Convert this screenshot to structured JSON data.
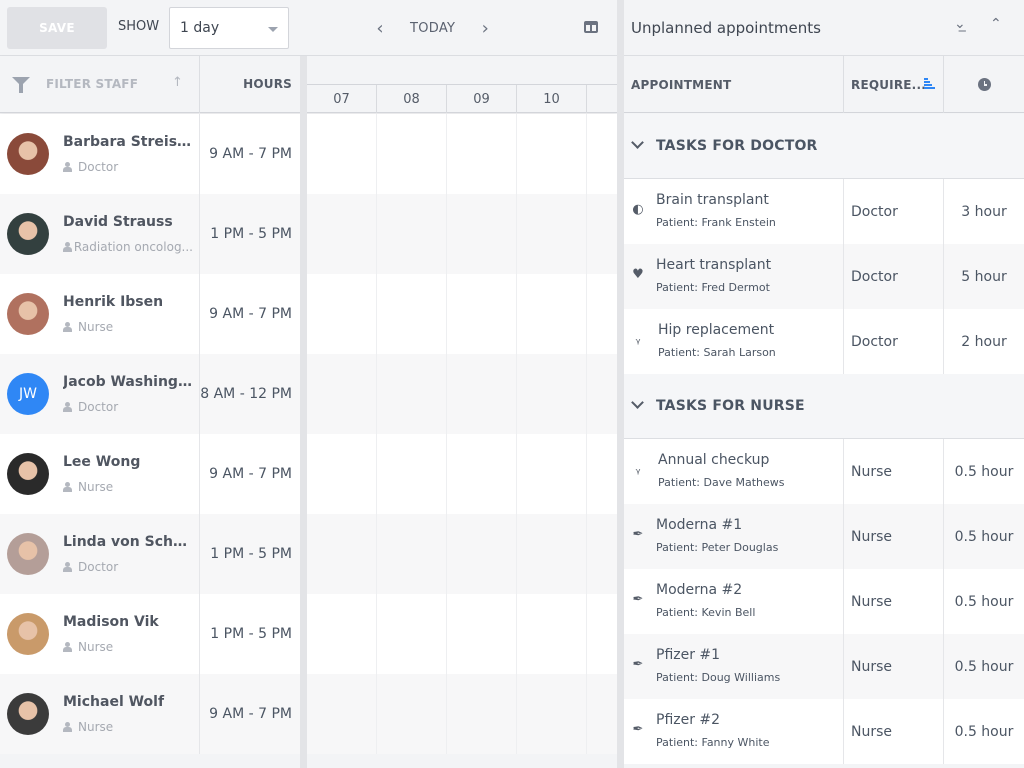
{
  "toolbar": {
    "save_label": "SAVE",
    "show_label": "SHOW",
    "show_value": "1 day",
    "today_label": "TODAY",
    "prev_icon": "chevron-left-icon",
    "next_icon": "chevron-right-icon",
    "layout_icon": "layout-columns-icon"
  },
  "grid": {
    "filter_label": "FILTER STAFF",
    "hours_header": "HOURS",
    "time_columns": [
      "07",
      "08",
      "09",
      "10"
    ]
  },
  "staff": [
    {
      "name": "Barbara Streisa...",
      "role": "Doctor",
      "hours": "9 AM - 7 PM",
      "avatar": "photo",
      "initials": "",
      "color": "#8a4a3a"
    },
    {
      "name": "David Strauss",
      "role": "Radiation oncolog...",
      "hours": "1 PM - 5 PM",
      "avatar": "photo",
      "initials": "",
      "color": "#33403f"
    },
    {
      "name": "Henrik Ibsen",
      "role": "Nurse",
      "hours": "9 AM - 7 PM",
      "avatar": "photo",
      "initials": "",
      "color": "#b0715f"
    },
    {
      "name": "Jacob Washingt...",
      "role": "Doctor",
      "hours": "8 AM - 12 PM",
      "avatar": "initials",
      "initials": "JW",
      "color": "#2f87f5"
    },
    {
      "name": "Lee Wong",
      "role": "Nurse",
      "hours": "9 AM - 7 PM",
      "avatar": "photo",
      "initials": "",
      "color": "#2a2a2a"
    },
    {
      "name": "Linda von Schmi...",
      "role": "Doctor",
      "hours": "1 PM - 5 PM",
      "avatar": "photo",
      "initials": "",
      "color": "#b49e98"
    },
    {
      "name": "Madison Vik",
      "role": "Nurse",
      "hours": "1 PM - 5 PM",
      "avatar": "photo",
      "initials": "",
      "color": "#c99a6a"
    },
    {
      "name": "Michael Wolf",
      "role": "Nurse",
      "hours": "9 AM - 7 PM",
      "avatar": "photo",
      "initials": "",
      "color": "#3b3b3b"
    }
  ],
  "unplanned": {
    "title": "Unplanned appointments",
    "expand_all_icon": "chevrons-down-icon",
    "collapse_all_icon": "chevrons-up-icon",
    "columns": {
      "appointment": "APPOINTMENT",
      "required": "REQUIRE...",
      "duration_icon": "clock-icon"
    },
    "accent_color": "#2f87f5",
    "groups": [
      {
        "label": "TASKS FOR DOCTOR",
        "tasks": [
          {
            "name": "Brain transplant",
            "patient": "Patient: Frank Enstein",
            "required": "Doctor",
            "duration": "3 hour",
            "icon": "brain-icon"
          },
          {
            "name": "Heart transplant",
            "patient": "Patient: Fred Dermot",
            "required": "Doctor",
            "duration": "5 hour",
            "icon": "heart-icon"
          },
          {
            "name": "Hip replacement",
            "patient": "Patient: Sarah Larson",
            "required": "Doctor",
            "duration": "2 hour",
            "icon": "stethoscope-icon"
          }
        ]
      },
      {
        "label": "TASKS FOR NURSE",
        "tasks": [
          {
            "name": "Annual checkup",
            "patient": "Patient: Dave Mathews",
            "required": "Nurse",
            "duration": "0.5 hour",
            "icon": "stethoscope-icon"
          },
          {
            "name": "Moderna #1",
            "patient": "Patient: Peter Douglas",
            "required": "Nurse",
            "duration": "0.5 hour",
            "icon": "syringe-icon"
          },
          {
            "name": "Moderna #2",
            "patient": "Patient: Kevin Bell",
            "required": "Nurse",
            "duration": "0.5 hour",
            "icon": "syringe-icon"
          },
          {
            "name": "Pfizer #1",
            "patient": "Patient: Doug Williams",
            "required": "Nurse",
            "duration": "0.5 hour",
            "icon": "syringe-icon"
          },
          {
            "name": "Pfizer #2",
            "patient": "Patient: Fanny White",
            "required": "Nurse",
            "duration": "0.5 hour",
            "icon": "syringe-icon"
          }
        ]
      }
    ]
  }
}
